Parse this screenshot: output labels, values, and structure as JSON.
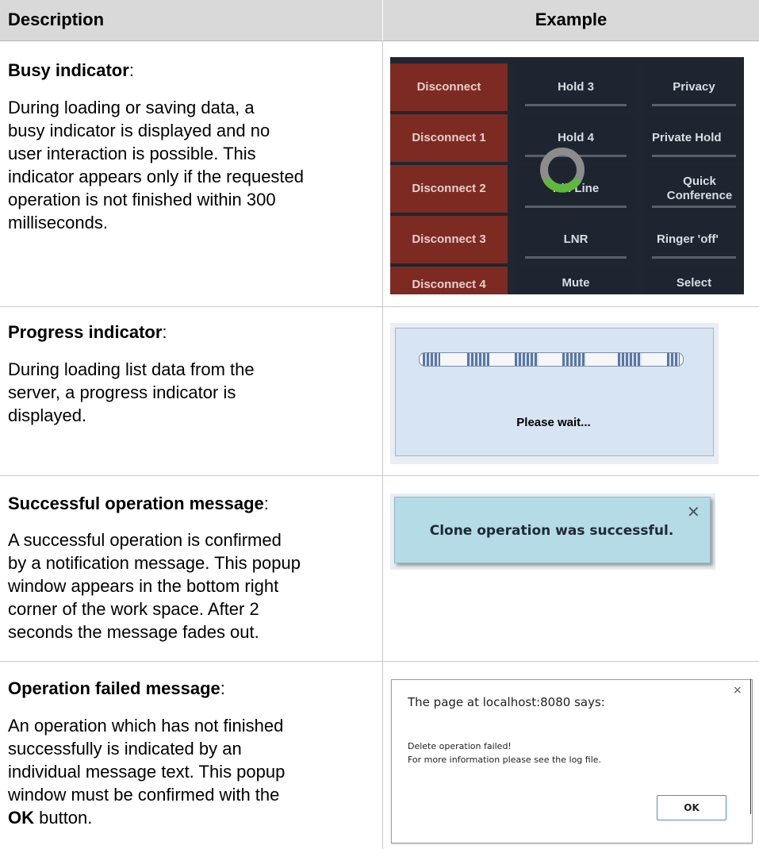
{
  "header": {
    "description": "Description",
    "example": "Example"
  },
  "rows": [
    {
      "title": "Busy indicator",
      "body": [
        "During loading or saving data, a",
        "busy indicator is displayed and no",
        "user interaction is possible. This",
        "indicator appears only if the requested",
        "operation is not finished within 300",
        "milliseconds."
      ]
    },
    {
      "title": "Progress indicator",
      "body": [
        "During loading list data from the",
        "server, a progress indicator is",
        "displayed."
      ]
    },
    {
      "title": "Successful operation message",
      "body": [
        "A successful operation is confirmed",
        "by a notification message. This popup",
        "window appears in the bottom right",
        "corner of the work space. After 2",
        "seconds the message fades out."
      ]
    },
    {
      "title": "Operation failed message",
      "body": [
        "An operation which has not finished",
        "successfully is indicated by an",
        "individual message text. This popup",
        "window must be confirmed with the"
      ],
      "body_bold": "OK",
      "body_end": " button."
    }
  ],
  "busy_example": {
    "col1": [
      "Disconnect",
      "Disconnect 1",
      "Disconnect 2",
      "Disconnect 3",
      "Disconnect 4"
    ],
    "col2": [
      "Hold 3",
      "Hold 4",
      "Kill Line",
      "LNR",
      "Mute"
    ],
    "col3": [
      "Privacy",
      "Private Hold",
      "Quick Conference",
      "Ringer 'off'",
      "Select"
    ],
    "colors": {
      "red": "#7d2a22",
      "dark": "#1e2530",
      "spinner_gray": "#8c8c8c",
      "spinner_green": "#5fb83c"
    }
  },
  "progress_example": {
    "label": "Please wait..."
  },
  "success_example": {
    "text": "Clone operation was successful.",
    "close": "✕"
  },
  "failed_example": {
    "title": "The page at localhost:8080 says:",
    "close": "×",
    "line1": "Delete operation failed!",
    "line2": "For more information please see the log file.",
    "ok": "OK"
  }
}
